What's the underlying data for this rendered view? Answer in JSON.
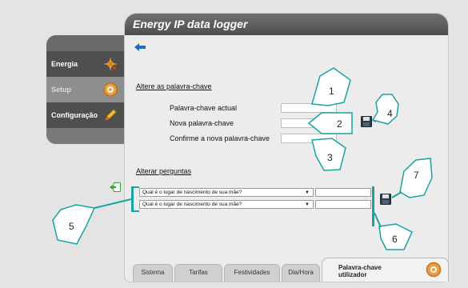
{
  "window": {
    "title": "Energy IP data logger"
  },
  "nav": {
    "items": [
      {
        "label": "Energia",
        "icon": "energy-sparkle-icon"
      },
      {
        "label": "Setup",
        "icon": "gear-icon"
      },
      {
        "label": "Configuração",
        "icon": "pencil-icon"
      }
    ]
  },
  "password_section": {
    "title": "Altere as palavra-chave",
    "current_label": "Palavra-chave actual",
    "new_label": "Nova palavra-chave",
    "confirm_label": "Confirme a nova palavra-chave",
    "current_value": "",
    "new_value": "",
    "confirm_value": ""
  },
  "questions_section": {
    "title": "Alterar perguntas",
    "question1": "Qual é o lugar de nascimento de sua mãe?",
    "question2": "Qual é o lugar de nascimento de sua mãe?",
    "answer1": "",
    "answer2": ""
  },
  "callouts": [
    "1",
    "2",
    "3",
    "4",
    "5",
    "6",
    "7"
  ],
  "tabs": [
    "Sistema",
    "Tarifas",
    "Festividades",
    "Dia/Hora",
    "Palavra-chave utilizador"
  ],
  "colors": {
    "accent_teal": "#1aa3a3",
    "header_gray": "#5a5a5a",
    "arrow_blue": "#1a6fc4"
  }
}
